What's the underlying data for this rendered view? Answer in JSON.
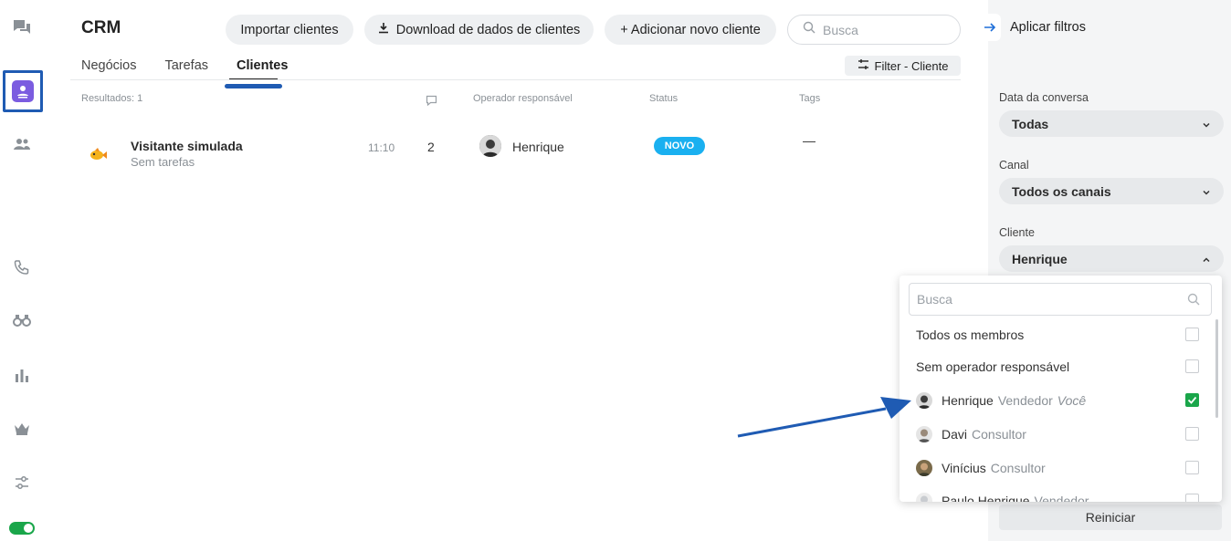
{
  "app": {
    "title": "CRM"
  },
  "header": {
    "import_label": "Importar clientes",
    "download_label": "Download de dados de clientes",
    "add_label": "+ Adicionar novo cliente",
    "search_placeholder": "Busca"
  },
  "tabs": [
    {
      "label": "Negócios",
      "active": false
    },
    {
      "label": "Tarefas",
      "active": false
    },
    {
      "label": "Clientes",
      "active": true
    }
  ],
  "filter_button": "Filter - Cliente",
  "table": {
    "results": "Resultados: 1",
    "columns": {
      "operator": "Operador responsável",
      "status": "Status",
      "tags": "Tags"
    },
    "rows": [
      {
        "name": "Visitante simulada",
        "subtitle": "Sem tarefas",
        "time": "11:10",
        "count": "2",
        "operator": "Henrique",
        "status": "NOVO",
        "tags": "—"
      }
    ]
  },
  "filters": {
    "apply_label": "Aplicar filtros",
    "date": {
      "label": "Data da conversa",
      "value": "Todas"
    },
    "channel": {
      "label": "Canal",
      "value": "Todos os canais"
    },
    "client": {
      "label": "Cliente",
      "value": "Henrique"
    },
    "reset_label": "Reiniciar"
  },
  "dropdown": {
    "search_placeholder": "Busca",
    "items": [
      {
        "name": "Todos os membros",
        "role": "",
        "you": "",
        "checked": false
      },
      {
        "name": "Sem operador responsável",
        "role": "",
        "you": "",
        "checked": false
      },
      {
        "name": "Henrique",
        "role": "Vendedor",
        "you": "Você",
        "checked": true
      },
      {
        "name": "Davi",
        "role": "Consultor",
        "you": "",
        "checked": false
      },
      {
        "name": "Vinícius",
        "role": "Consultor",
        "you": "",
        "checked": false
      },
      {
        "name": "Paulo Henrique",
        "role": "Vendedor",
        "you": "",
        "checked": false
      }
    ]
  },
  "colors": {
    "accent": "#1f5bb3",
    "status_new": "#1ab0f0",
    "checkbox_checked": "#1aa64a",
    "rail_active": "#7b5ce0"
  },
  "icons": [
    "chat-icon",
    "crm-icon",
    "contacts-icon",
    "phone-icon",
    "binoculars-icon",
    "chart-icon",
    "crown-icon",
    "settings-sliders-icon",
    "online-toggle"
  ]
}
